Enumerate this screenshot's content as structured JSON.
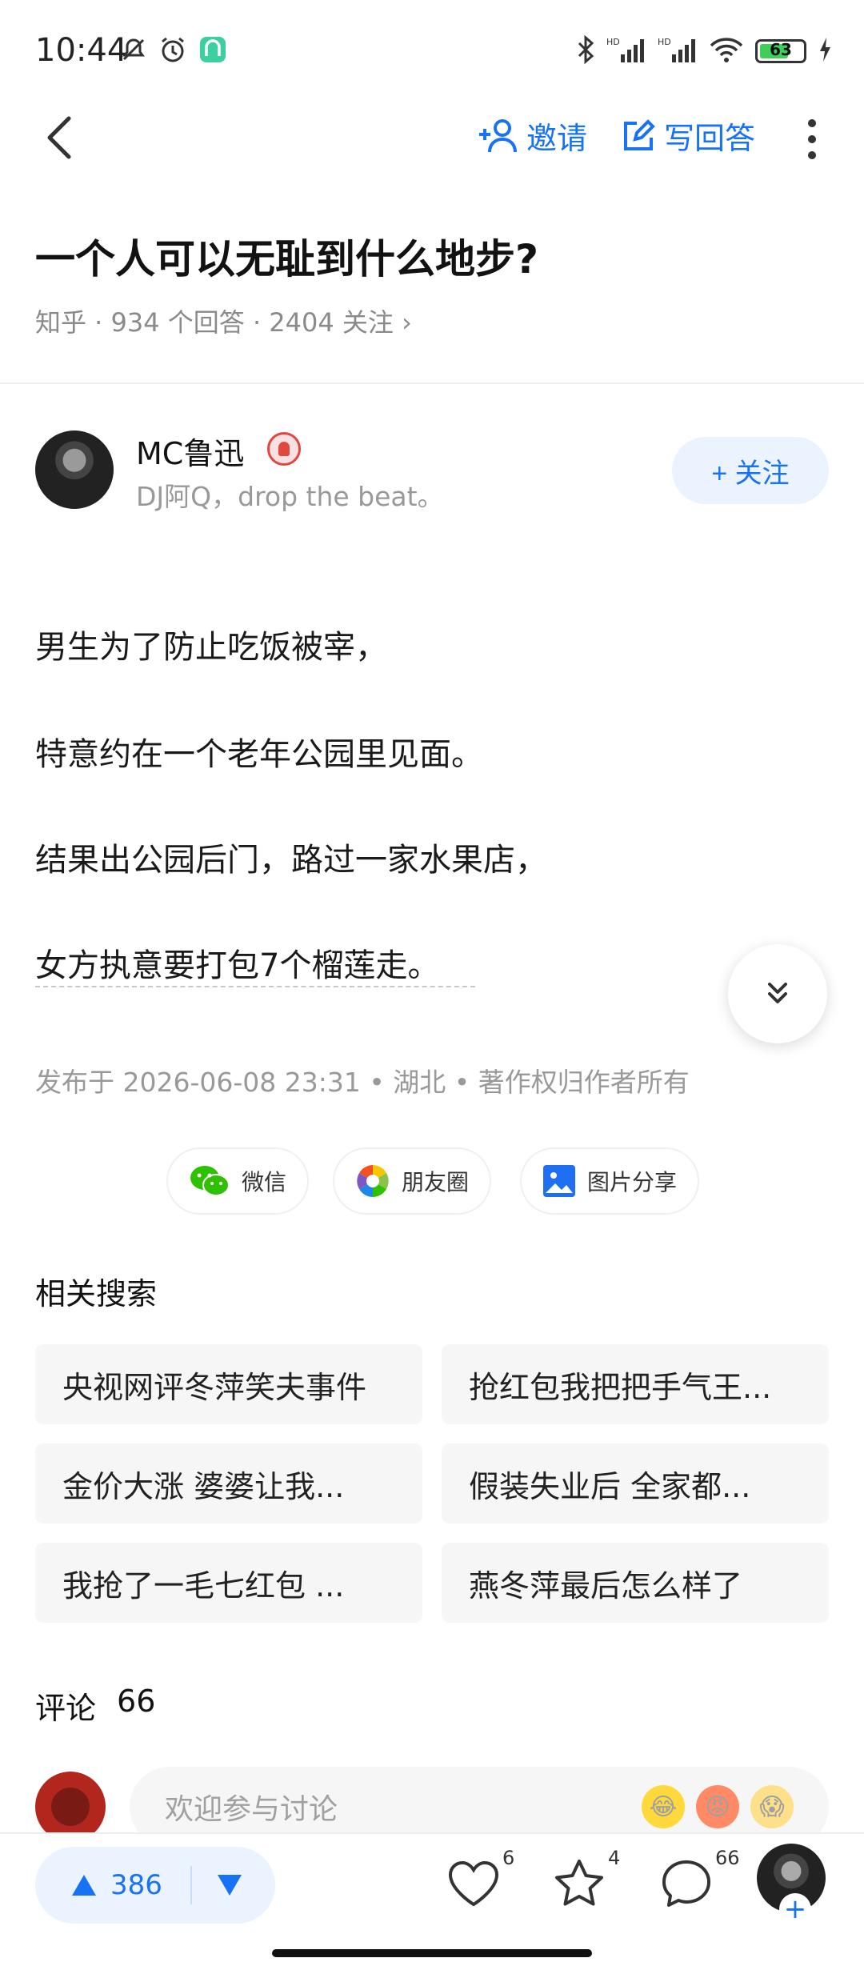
{
  "status_bar": {
    "time": "10:44",
    "battery_level": "63",
    "icons_left": [
      "mute-icon",
      "alarm-icon",
      "app-icon"
    ],
    "icons_right": [
      "bluetooth-icon",
      "hd-signal-icon",
      "hd-signal-icon",
      "wifi-icon",
      "battery-icon",
      "charging-icon"
    ]
  },
  "nav": {
    "invite_label": "邀请",
    "write_answer_label": "写回答"
  },
  "question": {
    "title": "一个人可以无耻到什么地步?",
    "meta": "知乎 · 934  个回答 · 2404  关注 ›"
  },
  "author": {
    "name": "MC鲁迅",
    "bio": "DJ阿Q，drop  the  beat。",
    "follow_label": "+ 关注"
  },
  "answer": {
    "paragraphs": [
      "男生为了防止吃饭被宰，",
      "特意约在一个老年公园里见面。",
      "结果出公园后门，路过一家水果店，",
      "女方执意要打包7个榴莲走。"
    ],
    "pubinfo": "发布于  2026-06-08  23:31 • 湖北 • 著作权归作者所有"
  },
  "share": {
    "wechat": "微信",
    "moments": "朋友圈",
    "image_share": "图片分享"
  },
  "related": {
    "title": "相关搜索",
    "items": [
      "央视网评冬萍笑夫事件",
      "抢红包我把把手气王...",
      "金价大涨  婆婆让我...",
      "假装失业后  全家都...",
      "我抢了一毛七红包  ...",
      "燕冬萍最后怎么样了"
    ]
  },
  "comments": {
    "title": "评论",
    "count": "66",
    "input_placeholder": "欢迎参与讨论",
    "emojis": [
      "😂",
      "😡",
      "😱"
    ]
  },
  "bottom_bar": {
    "upvotes": "386",
    "likes": "6",
    "favorites": "4",
    "comments": "66"
  },
  "colors": {
    "accent": "#1772f6",
    "accent_bg": "#ebf3ff"
  }
}
